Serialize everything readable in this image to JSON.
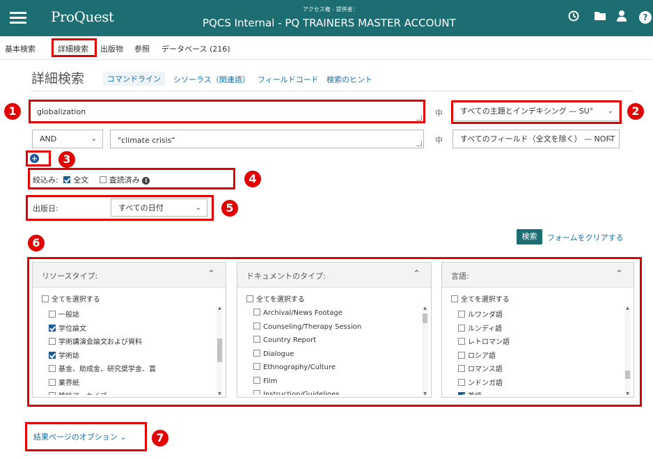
{
  "header": {
    "logo": "ProQuest",
    "access_label": "アクセス権 - 提供者：",
    "account": "PQCS Internal - PQ TRAINERS MASTER ACCOUNT",
    "icons": [
      "menu-icon",
      "history-icon",
      "folder-icon",
      "user-icon",
      "help-icon"
    ],
    "help_glyph": "?"
  },
  "nav": {
    "items": [
      "基本検索",
      "詳細検索",
      "出版物",
      "参照",
      "データベース (216)"
    ]
  },
  "page": {
    "title": "詳細検索",
    "tabs": [
      "コマンドライン",
      "シソーラス（関連語）",
      "フィールドコード",
      "検索のヒント"
    ]
  },
  "search": {
    "row1_value": "globalization",
    "in_label": "中",
    "row1_field": "すべての主題とインデキシング — SU°",
    "row2_operator": "AND",
    "row2_value": "\"climate crisis\"",
    "row2_field": "すべてのフィールド（全文を除く） — NOFT"
  },
  "limits": {
    "label": "絞込み:",
    "fulltext": "全文",
    "fulltext_checked": true,
    "peer": "査読済み",
    "peer_checked": false,
    "info_glyph": "i"
  },
  "date": {
    "label": "出版日:",
    "value": "すべての日付"
  },
  "actions": {
    "search": "検索",
    "clear": "フォームをクリアする"
  },
  "facets": [
    {
      "title": "リソースタイプ:",
      "select_all": "全てを選択する",
      "items": [
        {
          "label": "一般誌",
          "checked": false
        },
        {
          "label": "学位論文",
          "checked": true
        },
        {
          "label": "学術講演会論文および資料",
          "checked": false
        },
        {
          "label": "学術誌",
          "checked": true
        },
        {
          "label": "基金、助成金、研究奨学金、賞",
          "checked": false
        },
        {
          "label": "業界紙",
          "checked": false
        },
        {
          "label": "雑誌アーカイブ",
          "checked": false
        }
      ]
    },
    {
      "title": "ドキュメントのタイプ:",
      "select_all": "全てを選択する",
      "items": [
        {
          "label": "Archival/News Footage",
          "checked": false
        },
        {
          "label": "Counseling/Therapy Session",
          "checked": false
        },
        {
          "label": "Country Report",
          "checked": false
        },
        {
          "label": "Dialogue",
          "checked": false
        },
        {
          "label": "Ethnography/Culture",
          "checked": false
        },
        {
          "label": "Film",
          "checked": false
        },
        {
          "label": "Instruction/Guidelines",
          "checked": false
        }
      ]
    },
    {
      "title": "言語:",
      "select_all": "全てを選択する",
      "items": [
        {
          "label": "ルワンダ語",
          "checked": false
        },
        {
          "label": "ルンディ語",
          "checked": false
        },
        {
          "label": "レトロマン語",
          "checked": false
        },
        {
          "label": "ロシア語",
          "checked": false
        },
        {
          "label": "ロマンス語",
          "checked": false
        },
        {
          "label": "ンドンガ語",
          "checked": false
        },
        {
          "label": "英語",
          "checked": true
        }
      ]
    }
  ],
  "results_options": "結果ページのオプション",
  "annotations": [
    "1",
    "2",
    "3",
    "4",
    "5",
    "6",
    "7"
  ],
  "colors": {
    "header": "#1d6e72",
    "annotation": "#e00000",
    "link": "#1a6fa3",
    "checkbox": "#1d5a96"
  }
}
